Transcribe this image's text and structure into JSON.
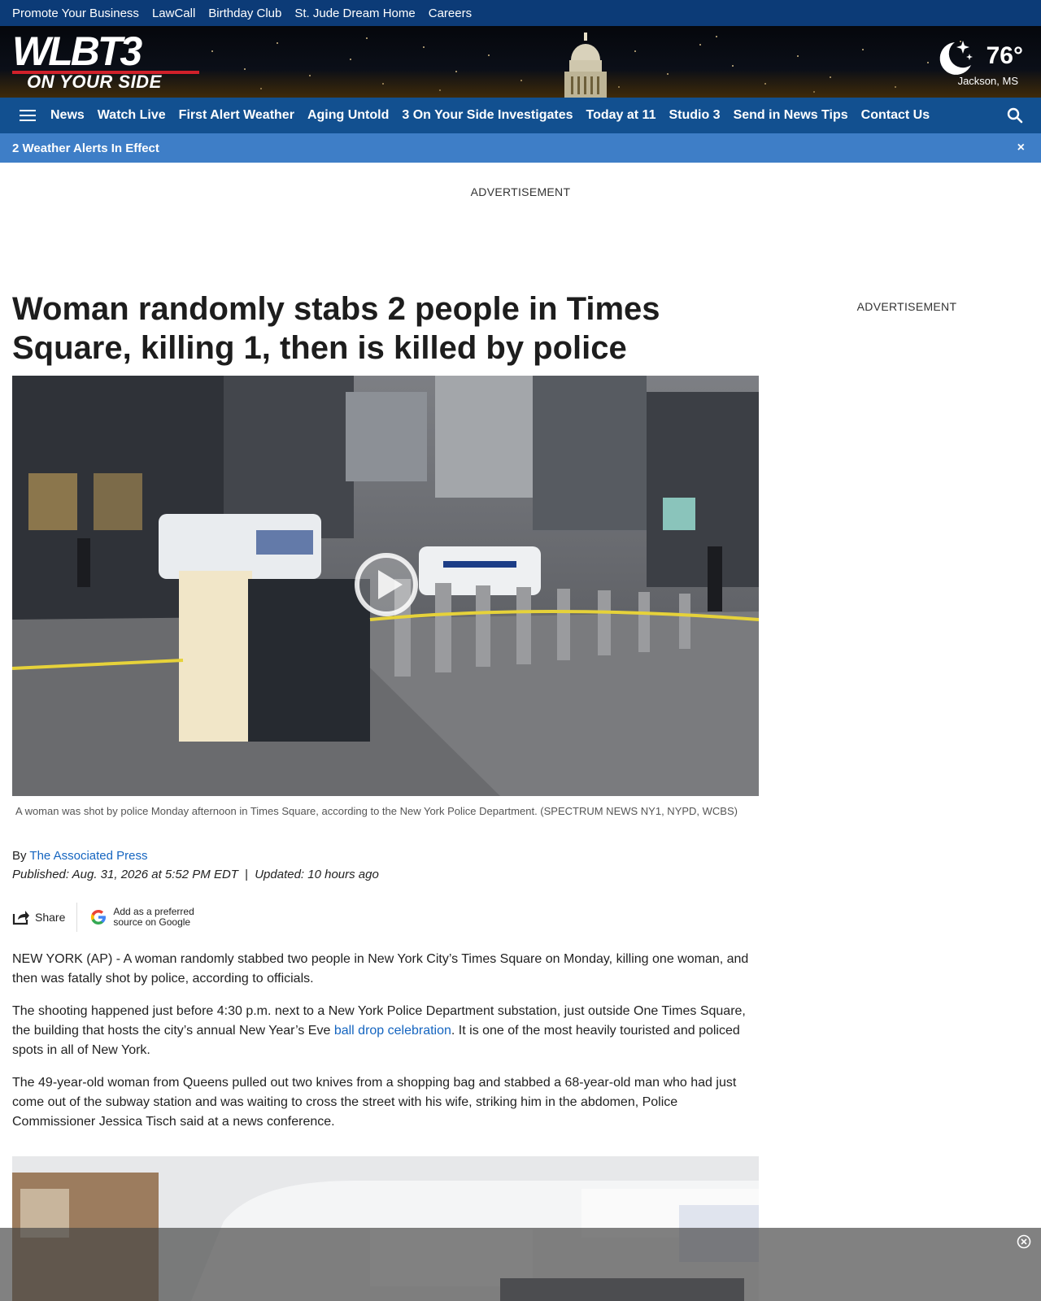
{
  "utility_nav": {
    "items": [
      "Promote Your Business",
      "LawCall",
      "Birthday Club",
      "St. Jude Dream Home",
      "Careers"
    ]
  },
  "masthead": {
    "logo_text": "WLBT3",
    "logo_tagline": "ON YOUR SIDE",
    "weather": {
      "temp": "76°",
      "location": "Jackson, MS",
      "icon": "moon-stars-icon"
    }
  },
  "main_nav": {
    "items": [
      "News",
      "Watch Live",
      "First Alert Weather",
      "Aging Untold",
      "3 On Your Side Investigates",
      "Today at 11",
      "Studio 3",
      "Send in News Tips",
      "Contact Us"
    ]
  },
  "alerts": {
    "text": "2 Weather Alerts In Effect",
    "close": "×"
  },
  "ads": {
    "top_label": "ADVERTISEMENT",
    "side_label": "ADVERTISEMENT"
  },
  "article": {
    "headline": "Woman randomly stabs 2 people in Times Square, killing 1, then is killed by police",
    "caption": "A woman was shot by police Monday afternoon in Times Square, according to the New York Police Department. (SPECTRUM NEWS NY1, NYPD, WCBS)",
    "byline_prefix": "By",
    "author": "The Associated Press",
    "published": "Published: Aug. 31, 2026 at 5:52 PM EDT",
    "separator": "|",
    "updated": "Updated: 10 hours ago",
    "share_label": "Share",
    "google_line1": "Add as a preferred",
    "google_line2": "source on Google",
    "paragraph1": "NEW YORK (AP) - A woman randomly stabbed two people in New York City’s Times Square on Monday, killing one woman, and then was fatally shot by police, according to officials.",
    "paragraph2_before": "The shooting happened just before 4:30 p.m. next to a New York Police Department substation, just outside One Times Square, the building that hosts the city’s annual New Year’s Eve ",
    "paragraph2_link": "ball drop celebration",
    "paragraph2_after": ". It is one of the most heavily touristed and policed spots in all of New York.",
    "paragraph3": "The 49-year-old woman from Queens pulled out two knives from a shopping bag and stabbed a 68-year-old man who had just come out of the subway station and was waiting to cross the street with his wife, striking him in the abdomen, Police Commissioner Jessica Tisch said at a news conference."
  },
  "colors": {
    "utility_bar": "#0c3b77",
    "nav": "#125090",
    "alerts": "#3e7ec7",
    "link": "#1565c0"
  }
}
